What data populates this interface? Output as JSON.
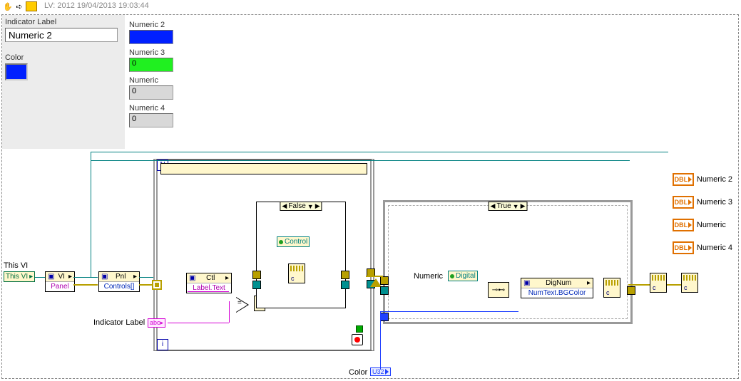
{
  "title": "LV: 2012 19/04/2013 19:03:44",
  "panel": {
    "indicator_label_caption": "Indicator Label",
    "indicator_label_value": "Numeric 2",
    "color_caption": "Color",
    "color_hex": "#0020ff"
  },
  "indicators": [
    {
      "label": "Numeric 2",
      "value": "",
      "style": "blue"
    },
    {
      "label": "Numeric 3",
      "value": "0",
      "style": "green"
    },
    {
      "label": "Numeric",
      "value": "0",
      "style": "plain"
    },
    {
      "label": "Numeric 4",
      "value": "0",
      "style": "plain"
    }
  ],
  "terminals": [
    "Numeric 2",
    "Numeric 3",
    "Numeric",
    "Numeric 4"
  ],
  "dbl_badge": "DBL",
  "diagram": {
    "this_vi_label": "This VI",
    "this_vi": "This VI",
    "vi_node": "VI",
    "panel_prop": "Panel",
    "pnl_node": "Pnl",
    "controls_prop": "Controls[]",
    "ctl_node": "Ctl",
    "label_text_prop": "Label.Text",
    "indicator_label_wire": "Indicator Label",
    "case_false": "False",
    "case_true": "True",
    "control_class": "Control",
    "numeric_class": "Numeric",
    "digital_class": "Digital",
    "dignum_node": "DigNum",
    "bgcolor_prop": "NumText.BGColor",
    "color_wire_label": "Color",
    "u32_badge": "U32",
    "abc_badge": "abc"
  }
}
